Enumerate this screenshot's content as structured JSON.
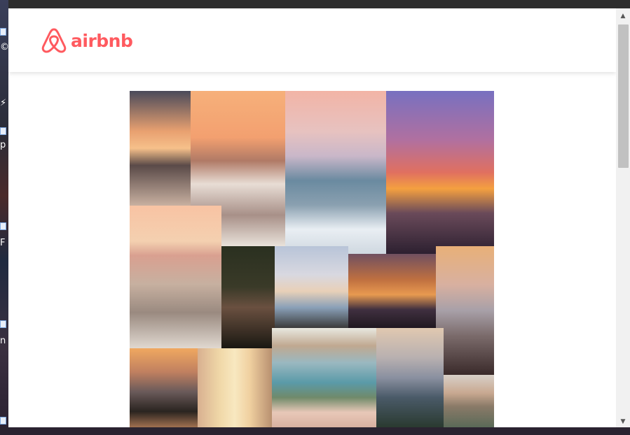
{
  "brand": {
    "name": "airbnb",
    "color": "#ff5a5f",
    "icon": "airbnb-belo-icon"
  },
  "collage": {
    "image_count": 16,
    "tiles": [
      {
        "name": "sailboat-sunset-photo",
        "colors": [
          "#3b3a4a",
          "#e8a070",
          "#f4c08a",
          "#c4b0a0"
        ]
      },
      {
        "name": "beach-waves-couple-photo",
        "colors": [
          "#f6b07a",
          "#f3a274",
          "#a97d6a",
          "#eae2da"
        ]
      },
      {
        "name": "sea-clouds-swimmers-photo",
        "colors": [
          "#f2b4a6",
          "#c9b7c9",
          "#6a8aa0",
          "#e9eef3"
        ]
      },
      {
        "name": "cliff-jump-sunset-photo",
        "colors": [
          "#8070b8",
          "#e07060",
          "#f4a040",
          "#2c2030"
        ]
      },
      {
        "name": "beach-picnic-sunset-photo",
        "colors": [
          "#f8c3a3",
          "#d9a090",
          "#c7b0a0",
          "#9a8a80"
        ]
      },
      {
        "name": "couple-swimming-forest-photo",
        "colors": [
          "#2a3020",
          "#3a3a28",
          "#1a1812",
          "#6a5040"
        ]
      },
      {
        "name": "palm-tree-beach-photo",
        "colors": [
          "#b8c4d8",
          "#e8d0b8",
          "#8aa0b8",
          "#3a3a3a"
        ]
      },
      {
        "name": "jetski-sunset-photo",
        "colors": [
          "#e89a50",
          "#c07040",
          "#403040",
          "#201820"
        ]
      },
      {
        "name": "cliff-friends-sea-photo",
        "colors": [
          "#e8b078",
          "#a8a0a8",
          "#7a6a6a",
          "#3a2a2a"
        ]
      },
      {
        "name": "car-road-trip-photo",
        "colors": [
          "#f0a860",
          "#6a5a5a",
          "#2a2420",
          "#a07050"
        ]
      },
      {
        "name": "curtain-sunlight-photo",
        "colors": [
          "#f0d8a8",
          "#d8b090",
          "#b89070",
          "#8a6a58"
        ]
      },
      {
        "name": "lagoon-wine-glasses-photo",
        "colors": [
          "#9ab8c0",
          "#5a9aa8",
          "#e8c8b8",
          "#708a6a"
        ]
      },
      {
        "name": "mountain-lake-photo",
        "colors": [
          "#e0c8b0",
          "#8a90a0",
          "#4a5a68",
          "#2a3a30"
        ]
      },
      {
        "name": "van-interior-photo",
        "colors": [
          "#c8a890",
          "#8a7a68",
          "#5a6a58",
          "#d8d0c8"
        ]
      }
    ]
  },
  "scrollbar": {
    "up_arrow": "▲",
    "down_arrow": "▼"
  }
}
